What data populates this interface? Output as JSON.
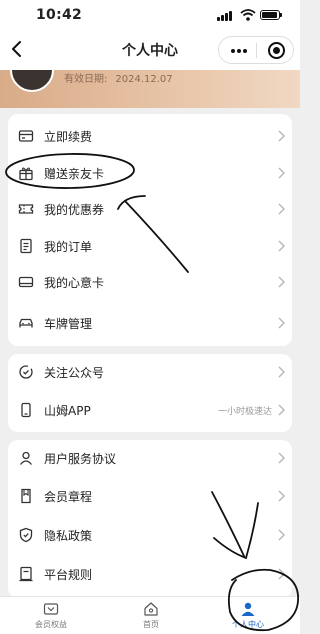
{
  "status_bar": {
    "time": "10:42"
  },
  "nav": {
    "title": "个人中心"
  },
  "member": {
    "validity_label": "有效日期:",
    "validity_date": "2024.12.07"
  },
  "groups": [
    {
      "items": [
        {
          "label": "立即续费",
          "icon": "renew-card-icon"
        },
        {
          "label": "赠送亲友卡",
          "icon": "gift-icon"
        },
        {
          "label": "我的优惠券",
          "icon": "coupon-icon"
        },
        {
          "label": "我的订单",
          "icon": "order-icon"
        },
        {
          "label": "我的心意卡",
          "icon": "gift-card-icon"
        },
        {
          "label": "车牌管理",
          "icon": "car-icon"
        }
      ]
    },
    {
      "items": [
        {
          "label": "关注公众号",
          "icon": "follow-icon"
        },
        {
          "label": "山姆APP",
          "icon": "phone-icon",
          "extra": "一小时极速达"
        }
      ]
    },
    {
      "items": [
        {
          "label": "用户服务协议",
          "icon": "user-agreement-icon"
        },
        {
          "label": "会员章程",
          "icon": "member-charter-icon"
        },
        {
          "label": "隐私政策",
          "icon": "privacy-shield-icon"
        },
        {
          "label": "平台规则",
          "icon": "platform-rules-icon"
        }
      ]
    }
  ],
  "tabs": [
    {
      "label": "会员权益",
      "icon": "member-benefits-icon",
      "active": false
    },
    {
      "label": "首页",
      "icon": "home-icon",
      "active": false
    },
    {
      "label": "个人中心",
      "icon": "person-icon",
      "active": true
    }
  ],
  "colors": {
    "accent": "#1a67c8",
    "banner": "#d9ab88",
    "background": "#efefef"
  }
}
